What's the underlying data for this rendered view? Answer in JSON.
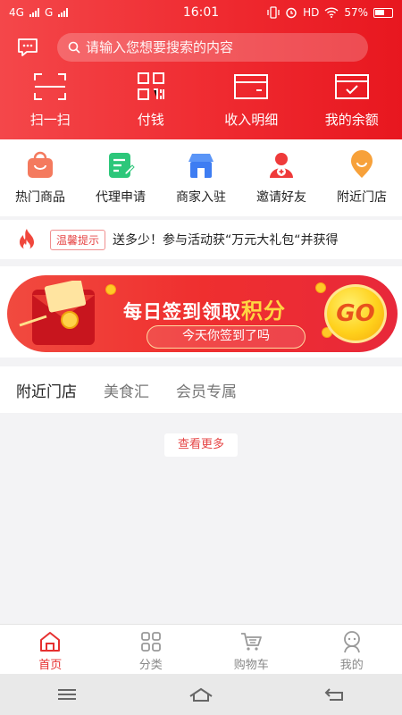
{
  "status": {
    "network1": "4G",
    "network2": "G",
    "time": "16:01",
    "hd": "HD",
    "battery": "57%"
  },
  "search": {
    "placeholder": "请输入您想要搜索的内容"
  },
  "quick_actions": [
    {
      "label": "扫一扫",
      "icon": "scan-icon"
    },
    {
      "label": "付钱",
      "icon": "qr-pay-icon"
    },
    {
      "label": "收入明细",
      "icon": "income-card-icon"
    },
    {
      "label": "我的余额",
      "icon": "balance-wallet-icon"
    }
  ],
  "categories": [
    {
      "label": "热门商品",
      "icon": "shopping-bag-icon"
    },
    {
      "label": "代理申请",
      "icon": "edit-form-icon"
    },
    {
      "label": "商家入驻",
      "icon": "shop-store-icon"
    },
    {
      "label": "邀请好友",
      "icon": "add-friend-icon"
    },
    {
      "label": "附近门店",
      "icon": "location-pin-icon"
    }
  ],
  "notice": {
    "tag": "温馨提示",
    "text": "送多少！参与活动获“万元大礼包“并获得"
  },
  "banner": {
    "title_part1": "每日签到领取",
    "title_highlight": "积分",
    "subtitle": "今天你签到了吗",
    "go": "GO"
  },
  "tabs": [
    {
      "label": "附近门店",
      "active": true
    },
    {
      "label": "美食汇",
      "active": false
    },
    {
      "label": "会员专属",
      "active": false
    }
  ],
  "more_button": "查看更多",
  "bottom_nav": [
    {
      "label": "首页",
      "icon": "home-icon",
      "active": true
    },
    {
      "label": "分类",
      "icon": "category-grid-icon",
      "active": false
    },
    {
      "label": "购物车",
      "icon": "cart-icon",
      "active": false
    },
    {
      "label": "我的",
      "icon": "profile-icon",
      "active": false
    }
  ],
  "colors": {
    "brand_red": "#ef2a30",
    "accent_gold": "#ffd11c",
    "text_dark": "#222222"
  }
}
